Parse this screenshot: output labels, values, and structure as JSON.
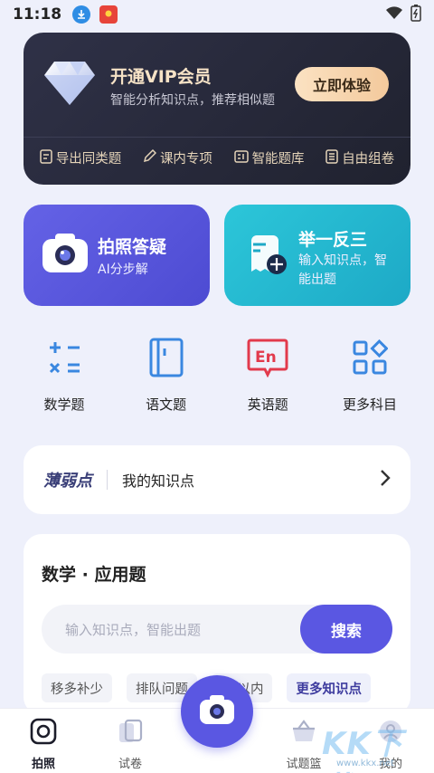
{
  "status_bar": {
    "time": "11:18"
  },
  "vip": {
    "title": "开通VIP会员",
    "subtitle": "智能分析知识点，推荐相似题",
    "button": "立即体验",
    "links": [
      "导出同类题",
      "课内专项",
      "智能题库",
      "自由组卷"
    ]
  },
  "features": {
    "photo": {
      "title": "拍照答疑",
      "subtitle": "AI分步解"
    },
    "generate": {
      "title": "举一反三",
      "subtitle_line1": "输入知识点，智",
      "subtitle_line2": "能出题"
    }
  },
  "subjects": [
    "数学题",
    "语文题",
    "英语题",
    "更多科目"
  ],
  "weak": {
    "logo": "薄弱点",
    "label": "我的知识点"
  },
  "math": {
    "title": "数学 · 应用题",
    "search_placeholder": "输入知识点，智能出题",
    "search_button": "搜索",
    "chips": [
      "移多补少",
      "排队问题",
      "20以内",
      "更多知识点"
    ]
  },
  "tabs": [
    "拍照",
    "试卷",
    "试题篮",
    "我的"
  ],
  "watermark": {
    "text": "KK下载",
    "url": "www.kkx.net"
  },
  "colors": {
    "primary": "#5a57e2",
    "teal": "#1da9c6",
    "vip_bg": "#2a2c3e",
    "gold": "#f3c99c",
    "english": "#e23a4c"
  }
}
